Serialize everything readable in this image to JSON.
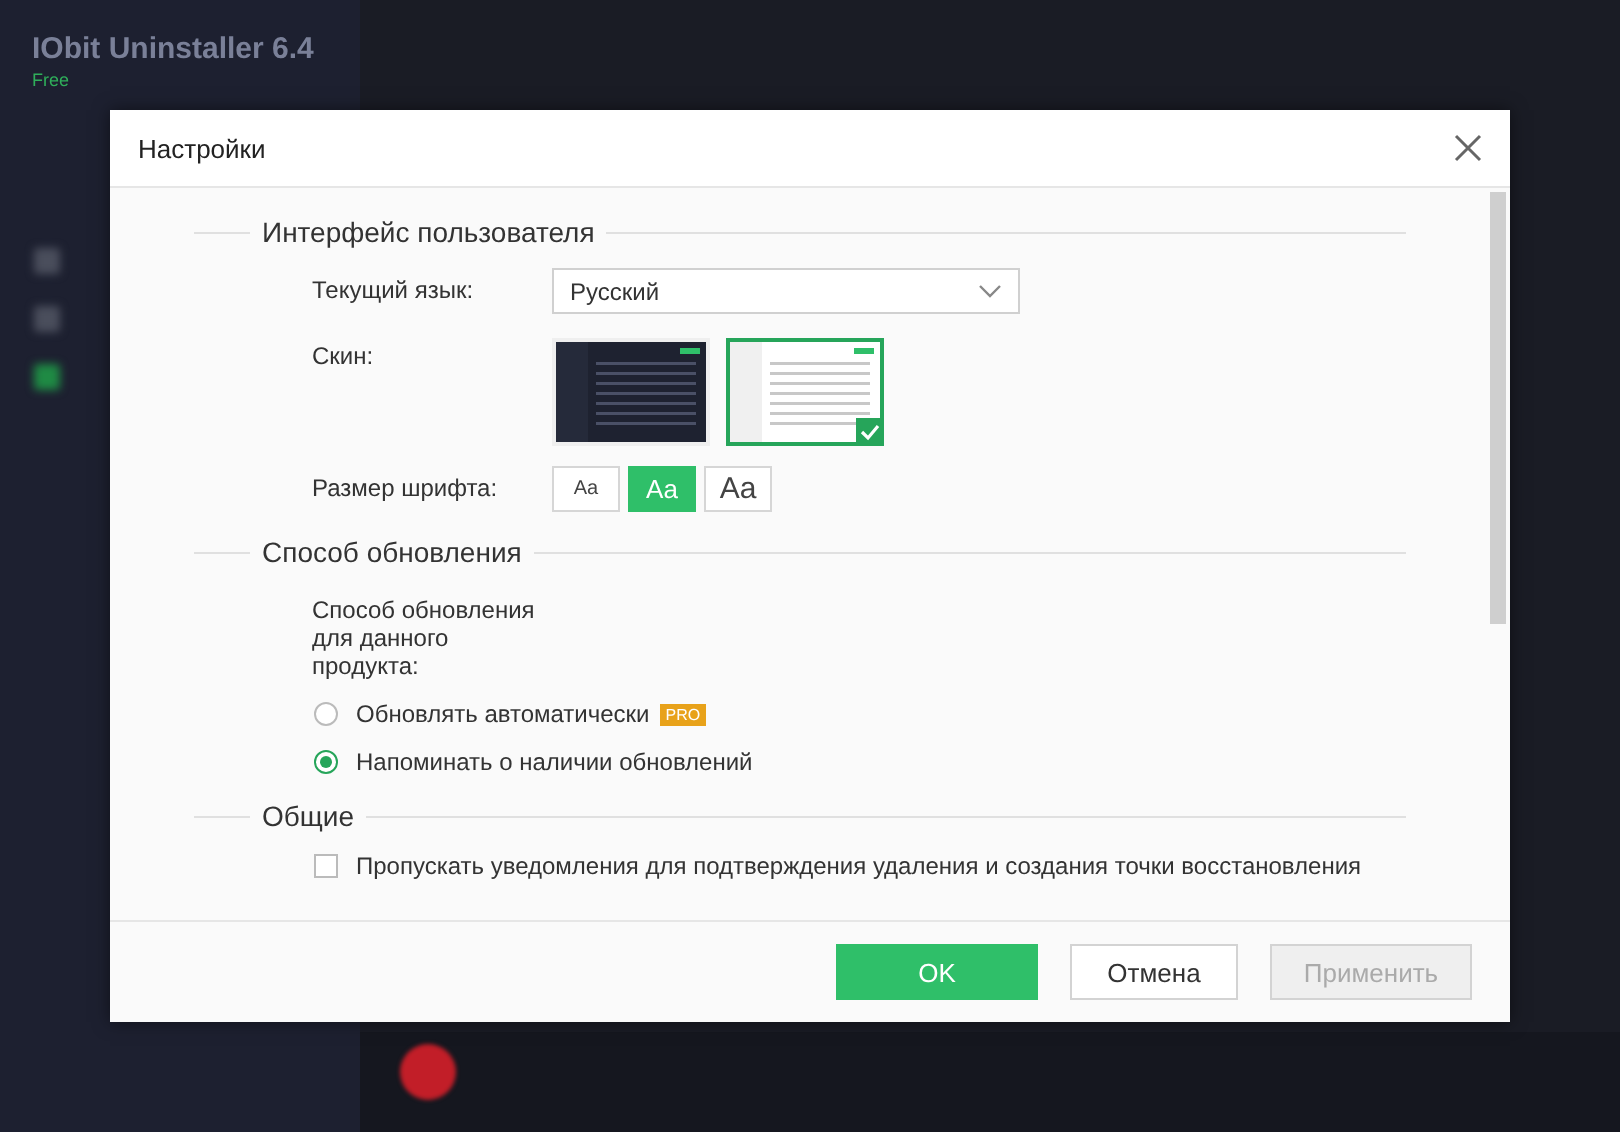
{
  "app": {
    "title": "IObit Uninstaller 6.4",
    "badge": "Free"
  },
  "dialog": {
    "title": "Настройки",
    "sections": [
      {
        "title": "Интерфейс пользователя",
        "rows": [
          {
            "kind": "dropdown",
            "label": "Текущий язык:",
            "value": "Русский"
          },
          {
            "kind": "skins",
            "label": "Скин:",
            "options": [
              {
                "kind": "dark",
                "selected": false
              },
              {
                "kind": "light",
                "selected": true
              }
            ]
          },
          {
            "kind": "fontsize",
            "label": "Размер шрифта:",
            "options": [
              {
                "label": "Aa",
                "kind": "small",
                "selected": false
              },
              {
                "label": "Aa",
                "kind": "medium",
                "selected": true
              },
              {
                "label": "Aa",
                "kind": "large",
                "selected": false
              }
            ]
          }
        ]
      },
      {
        "title": "Способ обновления",
        "rows": [
          {
            "kind": "text",
            "label": "Способ обновления для данного продукта:"
          },
          {
            "kind": "radio",
            "label": "Обновлять автоматически",
            "badge": "PRO",
            "selected": false
          },
          {
            "kind": "radio",
            "label": "Напоминать о наличии обновлений",
            "selected": true
          }
        ]
      },
      {
        "title": "Общие",
        "rows": [
          {
            "kind": "checkbox",
            "label": "Пропускать уведомления для подтверждения удаления и создания точки восстановления",
            "checked": false
          }
        ]
      }
    ],
    "buttons": [
      {
        "label": "OK",
        "kind": "primary",
        "disabled": false
      },
      {
        "label": "Отмена",
        "kind": "normal",
        "disabled": false
      },
      {
        "label": "Применить",
        "kind": "normal",
        "disabled": true
      }
    ]
  }
}
